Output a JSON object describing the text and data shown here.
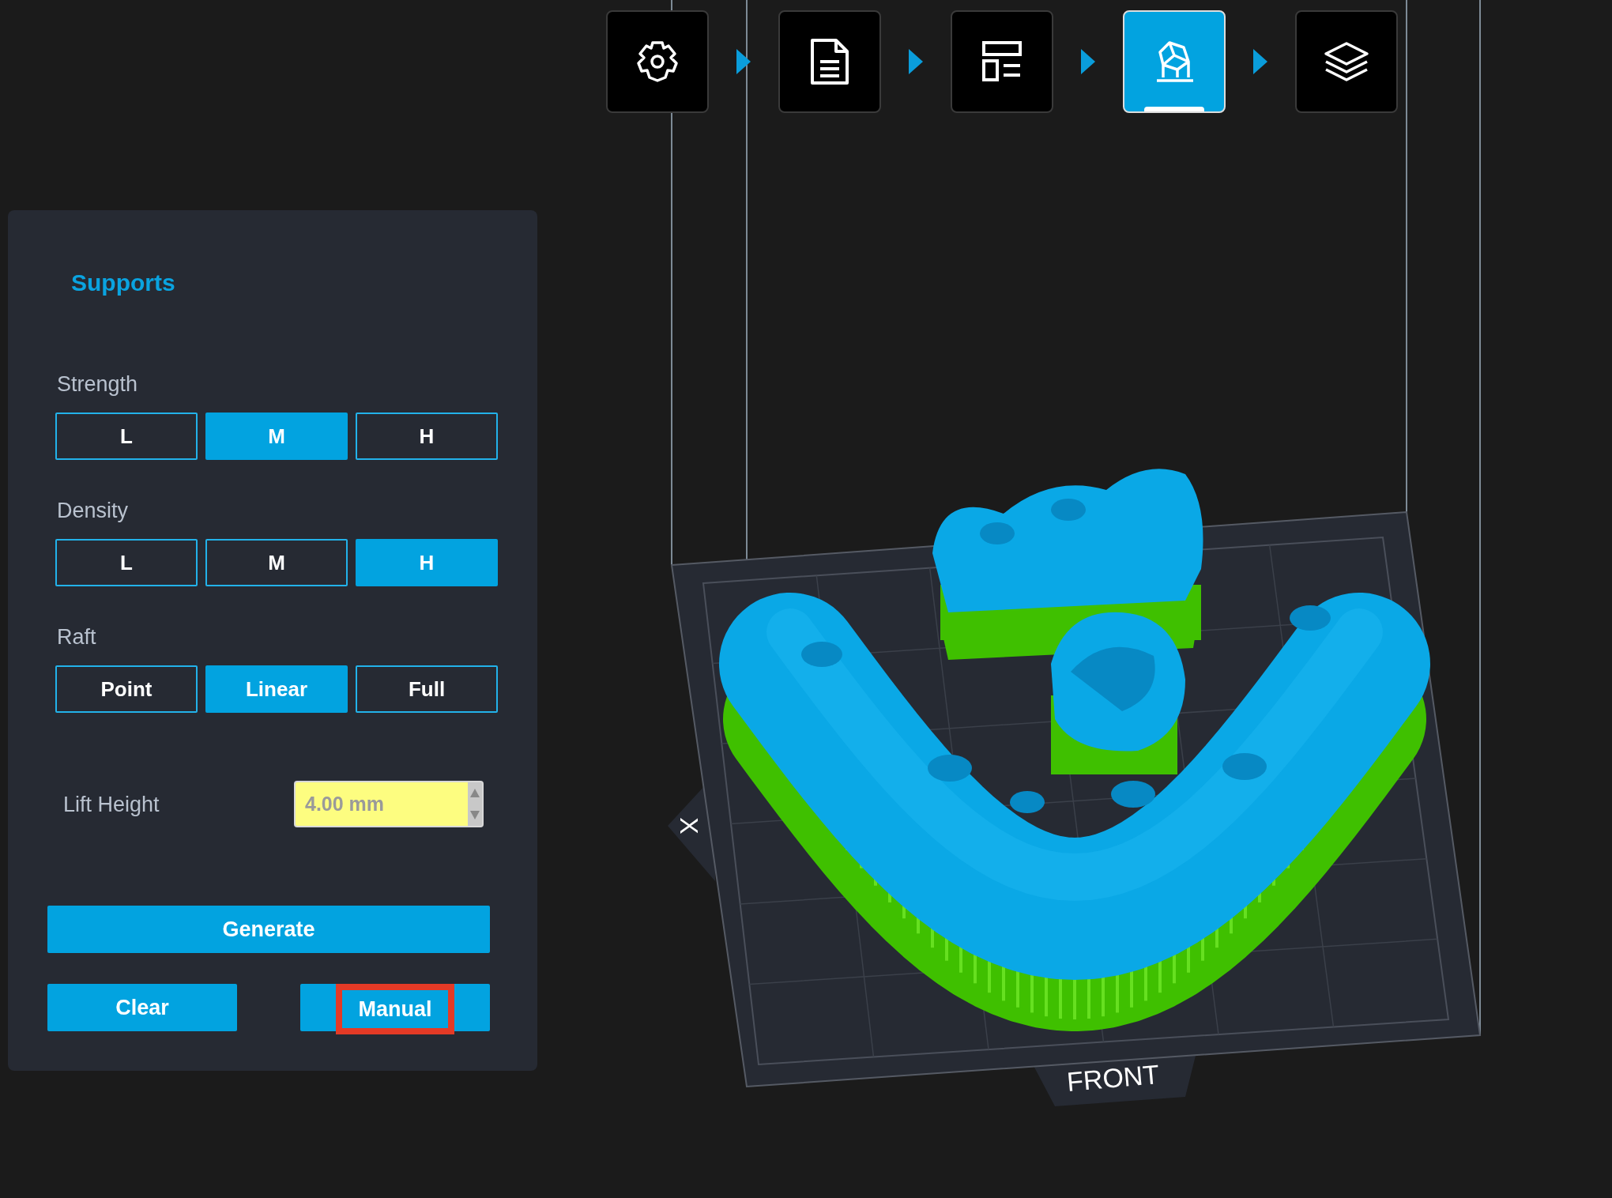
{
  "toolbar": {
    "steps": [
      {
        "selected": false
      },
      {
        "selected": false
      },
      {
        "selected": false
      },
      {
        "selected": true
      },
      {
        "selected": false
      }
    ]
  },
  "panel": {
    "title": "Supports",
    "groups": [
      {
        "label": "Strength",
        "options": [
          {
            "label": "L",
            "selected": false
          },
          {
            "label": "M",
            "selected": true
          },
          {
            "label": "H",
            "selected": false
          }
        ]
      },
      {
        "label": "Density",
        "options": [
          {
            "label": "L",
            "selected": false
          },
          {
            "label": "M",
            "selected": false
          },
          {
            "label": "H",
            "selected": true
          }
        ]
      },
      {
        "label": "Raft",
        "options": [
          {
            "label": "Point",
            "selected": false
          },
          {
            "label": "Linear",
            "selected": true
          },
          {
            "label": "Full",
            "selected": false
          }
        ]
      }
    ],
    "lift_height": {
      "label": "Lift Height",
      "value": "4.00 mm"
    },
    "buttons": [
      {
        "label": "Generate",
        "highlighted": false
      },
      {
        "label": "Clear",
        "highlighted": false
      },
      {
        "label": "Manual",
        "highlighted": true
      }
    ]
  },
  "viewport": {
    "axis_label": "X",
    "front_label": "FRONT"
  }
}
